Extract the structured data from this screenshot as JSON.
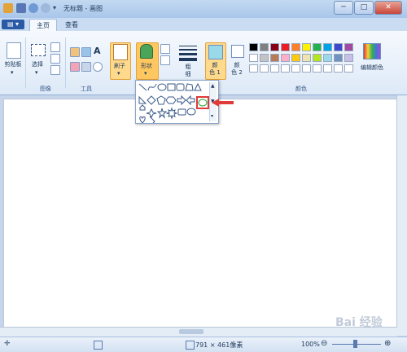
{
  "window": {
    "title": "无标题 - 画图",
    "close": "✕",
    "maximize": "□",
    "minimize": "─"
  },
  "tabs": [
    {
      "label": "主页"
    },
    {
      "label": "查看"
    }
  ],
  "file_menu": "▤ ▾",
  "ribbon": {
    "clipboard": {
      "label": "剪贴板",
      "group": ""
    },
    "image": {
      "select": "选择",
      "group": "图像"
    },
    "tools": {
      "group": "工具"
    },
    "brush": {
      "label": "刷子"
    },
    "shapes": {
      "label": "形状"
    },
    "size": {
      "label": "粗\n细"
    },
    "color1": {
      "label": "颜\n色 1"
    },
    "color2": {
      "label": "颜\n色 2"
    },
    "edit_colors": {
      "label": "编辑颜色"
    },
    "colors_group": "颜色"
  },
  "palette": {
    "row1": [
      "#000000",
      "#7f7f7f",
      "#880015",
      "#ed1c24",
      "#ff7f27",
      "#fff200",
      "#22b14c",
      "#00a2e8",
      "#3f48cc",
      "#a349a4"
    ],
    "row2": [
      "#ffffff",
      "#c3c3c3",
      "#b97a57",
      "#ffaec9",
      "#ffc90e",
      "#efe4b0",
      "#b5e61d",
      "#99d9ea",
      "#7092be",
      "#c8bfe7"
    ]
  },
  "status": {
    "dimensions": "791 × 461像素",
    "zoom": "100%",
    "zoom_minus": "⊖",
    "zoom_plus": "⊕"
  },
  "watermark": "Bai 经验"
}
